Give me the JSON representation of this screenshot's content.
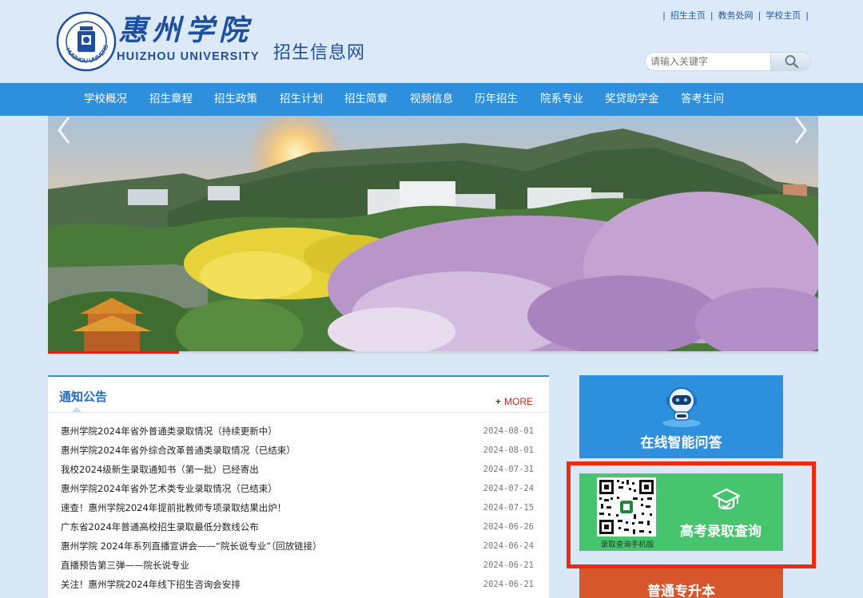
{
  "header": {
    "logo_cn": "惠州学院",
    "logo_en": "HUIZHOU UNIVERSITY",
    "site_name": "招生信息网",
    "seal_text": "HUIZHOU UNIVERSITY",
    "top_links": [
      "招生主页",
      "教务处网",
      "学校主页"
    ],
    "search_placeholder": "请输入关键字"
  },
  "nav": {
    "items": [
      "学校概况",
      "招生章程",
      "招生政策",
      "招生计划",
      "招生简章",
      "视频信息",
      "历年招生",
      "院系专业",
      "奖贷助学金",
      "答考生问"
    ]
  },
  "banner": {
    "progress": 0.17
  },
  "notice": {
    "title": "通知公告",
    "more": "MORE",
    "rows": [
      {
        "title": "惠州学院2024年省外普通类录取情况（持续更新中）",
        "date": "2024-08-01"
      },
      {
        "title": "惠州学院2024年省外综合改革普通类录取情况（已结束）",
        "date": "2024-08-01"
      },
      {
        "title": "我校2024级新生录取通知书（第一批）已经寄出",
        "date": "2024-07-31"
      },
      {
        "title": "惠州学院2024年省外艺术类专业录取情况（已结束）",
        "date": "2024-07-24"
      },
      {
        "title": "速查！惠州学院2024年提前批教师专项录取结果出炉！",
        "date": "2024-07-15"
      },
      {
        "title": "广东省2024年普通高校招生录取最低分数线公布",
        "date": "2024-06-26"
      },
      {
        "title": "惠州学院 2024年系列直播宣讲会——“院长说专业”（回放链接）",
        "date": "2024-06-24"
      },
      {
        "title": "直播预告第三弹——院长说专业",
        "date": "2024-06-21"
      },
      {
        "title": "关注！惠州学院2024年线下招生咨询会安排",
        "date": "2024-06-21"
      }
    ]
  },
  "side": {
    "qa_label": "在线智能问答",
    "score_label": "高考录取查询",
    "qr_caption": "录取查询手机版",
    "upgrade_label": "普通专升本"
  },
  "colors": {
    "nav": "#2e8fdc",
    "qa": "#2e8fdc",
    "score": "#47c56e",
    "upgrade": "#d7562c",
    "highlight": "#f02a10",
    "more": "#d7261b"
  }
}
